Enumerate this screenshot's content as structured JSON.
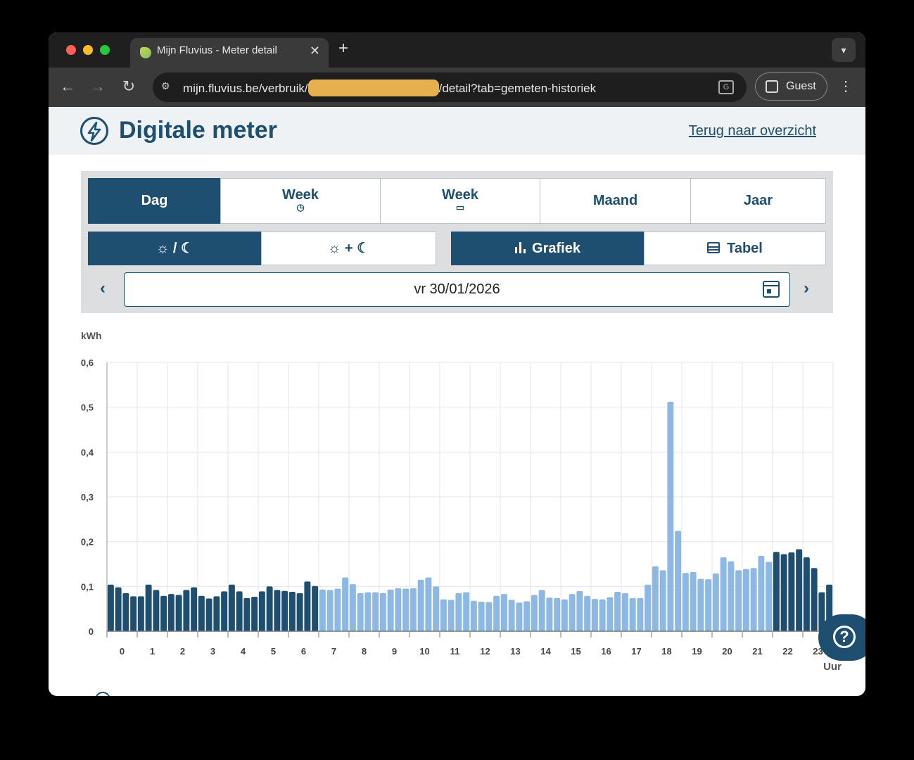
{
  "browser": {
    "tab_title": "Mijn Fluvius - Meter detail",
    "tab_close": "✕",
    "new_tab": "+",
    "url_prefix": "mijn.fluvius.be/verbruik/",
    "url_suffix": "/detail?tab=gemeten-historiek",
    "guest_label": "Guest",
    "colors": {
      "close": "#ff5f57",
      "minimize": "#febc2e",
      "maximize": "#28c840"
    }
  },
  "page": {
    "title": "Digitale meter",
    "back_link": "Terug naar overzicht"
  },
  "period_tabs": [
    {
      "label": "Dag",
      "sub": "",
      "active": true
    },
    {
      "label": "Week",
      "sub": "◷",
      "active": false
    },
    {
      "label": "Week",
      "sub": "▭",
      "active": false
    },
    {
      "label": "Maand",
      "sub": "",
      "active": false
    },
    {
      "label": "Jaar",
      "sub": "",
      "active": false
    }
  ],
  "tariff_toggle": [
    {
      "label": "☼ / ☾",
      "active": true
    },
    {
      "label": "☼ + ☾",
      "active": false
    }
  ],
  "view_toggle": [
    {
      "label": "Grafiek",
      "icon": "bar-chart-icon",
      "active": true
    },
    {
      "label": "Tabel",
      "icon": "table-icon",
      "active": false
    }
  ],
  "date": {
    "value": "vr 30/01/2026",
    "prev": "‹",
    "next": "›"
  },
  "chart_data": {
    "type": "bar",
    "ylabel": "kWh",
    "xlabel": "Uur",
    "ylim": [
      0,
      0.6
    ],
    "yticks": [
      "0",
      "0,1",
      "0,2",
      "0,3",
      "0,4",
      "0,5",
      "0,6"
    ],
    "xticks": [
      "0",
      "1",
      "2",
      "3",
      "4",
      "5",
      "6",
      "7",
      "8",
      "9",
      "10",
      "11",
      "12",
      "13",
      "14",
      "15",
      "16",
      "17",
      "18",
      "19",
      "20",
      "21",
      "22",
      "23"
    ],
    "interval": "15 min",
    "grid": true,
    "colors": {
      "night": "#1e4e70",
      "day": "#8db8e3"
    },
    "values": [
      0.104,
      0.098,
      0.085,
      0.078,
      0.078,
      0.104,
      0.092,
      0.079,
      0.083,
      0.081,
      0.092,
      0.098,
      0.079,
      0.073,
      0.078,
      0.089,
      0.104,
      0.089,
      0.074,
      0.077,
      0.089,
      0.1,
      0.092,
      0.09,
      0.088,
      0.085,
      0.111,
      0.101,
      0.093,
      0.092,
      0.095,
      0.12,
      0.105,
      0.085,
      0.087,
      0.087,
      0.085,
      0.093,
      0.096,
      0.095,
      0.096,
      0.115,
      0.12,
      0.1,
      0.071,
      0.07,
      0.085,
      0.087,
      0.068,
      0.066,
      0.065,
      0.079,
      0.083,
      0.07,
      0.064,
      0.067,
      0.081,
      0.092,
      0.075,
      0.074,
      0.071,
      0.083,
      0.09,
      0.079,
      0.072,
      0.071,
      0.076,
      0.088,
      0.085,
      0.074,
      0.074,
      0.104,
      0.145,
      0.136,
      0.512,
      0.224,
      0.13,
      0.132,
      0.117,
      0.116,
      0.129,
      0.165,
      0.156,
      0.136,
      0.139,
      0.141,
      0.168,
      0.155,
      0.177,
      0.172,
      0.176,
      0.183,
      0.165,
      0.141,
      0.087,
      0.104
    ],
    "tariff": [
      "night",
      "night",
      "night",
      "night",
      "night",
      "night",
      "night",
      "night",
      "night",
      "night",
      "night",
      "night",
      "night",
      "night",
      "night",
      "night",
      "night",
      "night",
      "night",
      "night",
      "night",
      "night",
      "night",
      "night",
      "night",
      "night",
      "night",
      "night",
      "day",
      "day",
      "day",
      "day",
      "day",
      "day",
      "day",
      "day",
      "day",
      "day",
      "day",
      "day",
      "day",
      "day",
      "day",
      "day",
      "day",
      "day",
      "day",
      "day",
      "day",
      "day",
      "day",
      "day",
      "day",
      "day",
      "day",
      "day",
      "day",
      "day",
      "day",
      "day",
      "day",
      "day",
      "day",
      "day",
      "day",
      "day",
      "day",
      "day",
      "day",
      "day",
      "day",
      "day",
      "day",
      "day",
      "day",
      "day",
      "day",
      "day",
      "day",
      "day",
      "day",
      "day",
      "day",
      "day",
      "day",
      "day",
      "day",
      "day",
      "night",
      "night",
      "night",
      "night",
      "night",
      "night",
      "night",
      "night"
    ]
  }
}
